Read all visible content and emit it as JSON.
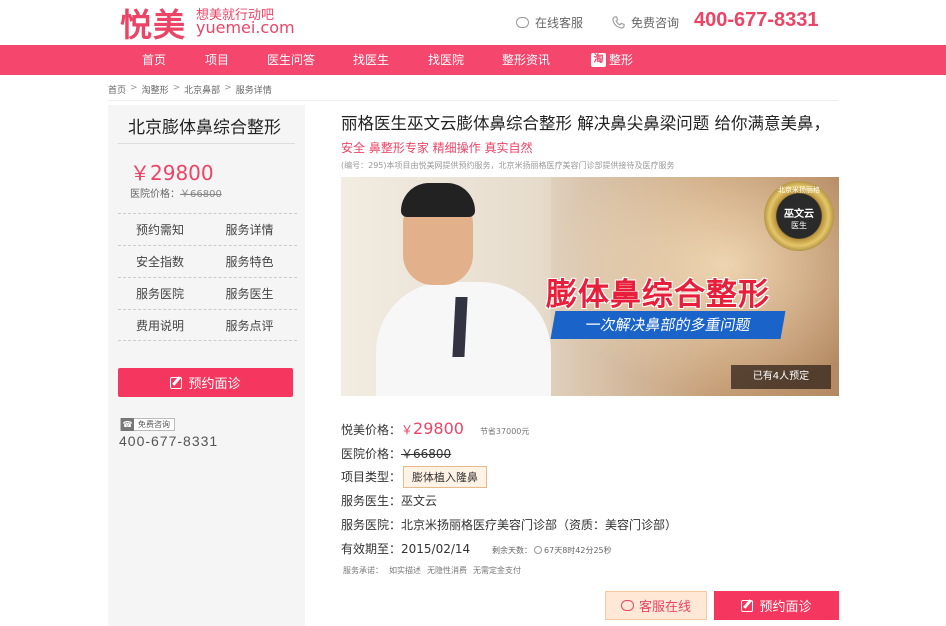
{
  "header": {
    "logo_text": "悦美",
    "slogan": "想美就行动吧",
    "domain": "yuemei.com",
    "online_service": "在线客服",
    "free_consult": "免费咨询",
    "phone": "400-677-8331"
  },
  "nav": {
    "items": [
      "首页",
      "项目",
      "医生问答",
      "找医生",
      "找医院",
      "整形资讯",
      "整形"
    ],
    "taobao_badge": "淘"
  },
  "breadcrumb": [
    "首页",
    "淘整形",
    "北京鼻部",
    "服务详情"
  ],
  "sidebar": {
    "title": "北京膨体鼻综合整形",
    "price": "￥29800",
    "hospital_price_label": "医院价格：",
    "hospital_price": "￥66800",
    "menu": [
      [
        "预约需知",
        "服务详情"
      ],
      [
        "安全指数",
        "服务特色"
      ],
      [
        "服务医院",
        "服务医生"
      ],
      [
        "费用说明",
        "服务点评"
      ]
    ],
    "book_button": "预约面诊",
    "free_consult_tag": "免费咨询",
    "phone": "400-677-8331"
  },
  "main": {
    "title": "丽格医生巫文云膨体鼻综合整形 解决鼻尖鼻梁问题 给你满意美鼻，",
    "title_highlight": "安全 鼻整形专家 精细操作 真实自然",
    "code_note": "(编号：295)本项目由悦美网提供预约服务，北京米扬丽格医疗美容门诊部提供接待及医疗服务",
    "banner": {
      "title": "膨体鼻综合整形",
      "subtitle": "一次解决鼻部的多重问题",
      "badge_top": "北京米扬丽格",
      "badge_name": "巫文云",
      "badge_role": "医生",
      "booked": "已有4人预定"
    },
    "yuemei_price_label": "悦美价格：",
    "yuemei_price_currency": "￥",
    "yuemei_price": "29800",
    "save_text": "节省37000元",
    "hospital_price_label": "医院价格：",
    "hospital_price": "￥66800",
    "type_label": "项目类型：",
    "type_value": "膨体植入隆鼻",
    "doctor_label": "服务医生：",
    "doctor_value": "巫文云",
    "hospital_label": "服务医院：",
    "hospital_value": "北京米扬丽格医疗美容门诊部（资质：美容门诊部）",
    "valid_label": "有效期至：",
    "valid_value": "2015/02/14",
    "remain_label": "剩余天数：",
    "remain_value": "67天8时42分25秒",
    "promise_label": "服务承诺：",
    "promises": [
      "如实描述",
      "无隐性消费",
      "无需定金支付"
    ],
    "chat_button": "客服在线",
    "book_button": "预约面诊"
  },
  "colors": {
    "brand": "#ec4466",
    "nav_bg": "#f5476d",
    "button": "#f5365e"
  }
}
